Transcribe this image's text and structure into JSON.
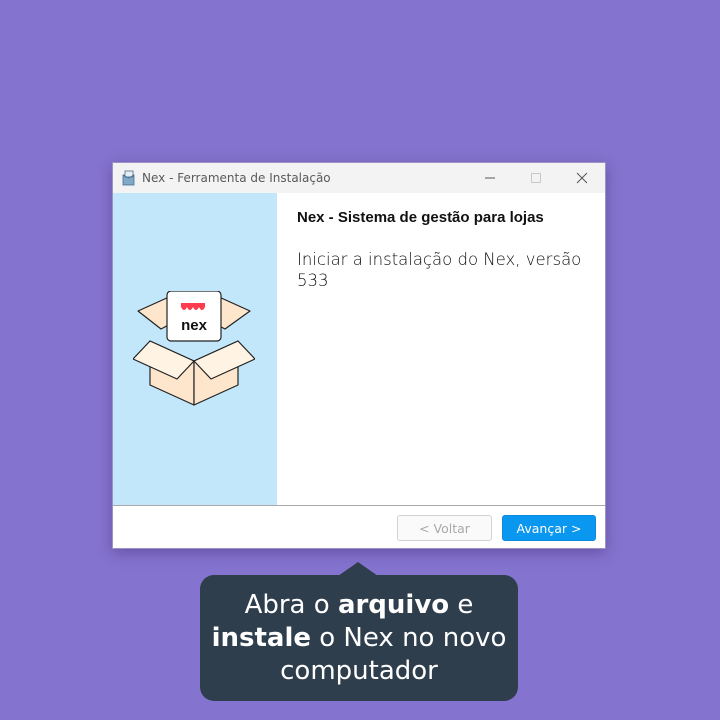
{
  "window": {
    "title": "Nex - Ferramenta de Instalação",
    "heading": "Nex - Sistema de gestão para lojas",
    "description": "Iniciar a instalação do Nex, versão 533",
    "logo_text": "nex",
    "buttons": {
      "back": "< Voltar",
      "next": "Avançar >"
    }
  },
  "tooltip": {
    "line1_a": "Abra o ",
    "line1_b": "arquivo",
    "line1_c": " e",
    "line2_a": "instale",
    "line2_b": " o Nex no novo",
    "line3": "computador"
  },
  "colors": {
    "background": "#8574cf",
    "left_panel": "#c3e7fa",
    "primary_button": "#0a97f0",
    "tooltip": "#2f3e4d",
    "logo_accent": "#ff3b4e"
  }
}
